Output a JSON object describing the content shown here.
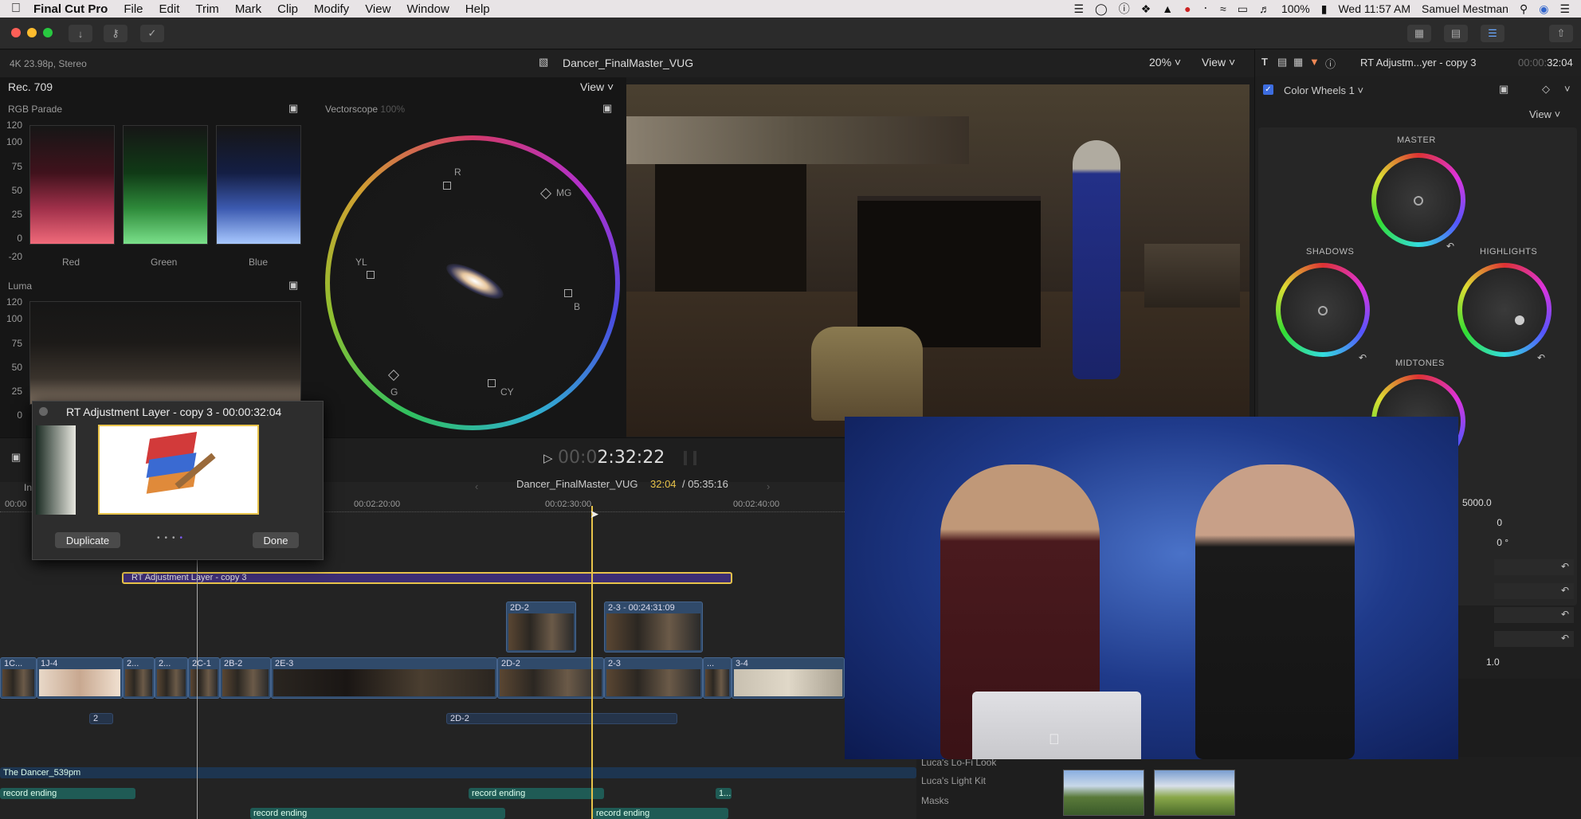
{
  "menubar": {
    "app": "Final Cut Pro",
    "items": [
      "File",
      "Edit",
      "Trim",
      "Mark",
      "Clip",
      "Modify",
      "View",
      "Window",
      "Help"
    ],
    "battery": "100%",
    "clock": "Wed 11:57 AM",
    "user": "Samuel Mestman"
  },
  "viewer_header": {
    "format": "4K 23.98p, Stereo",
    "project": "Dancer_FinalMaster_VUG",
    "zoom": "20%",
    "view_label": "View"
  },
  "scopes": {
    "colorspace": "Rec. 709",
    "view_label": "View",
    "rgb_title": "RGB Parade",
    "channels": [
      "Red",
      "Green",
      "Blue"
    ],
    "scale": [
      "120",
      "100",
      "75",
      "50",
      "25",
      "0",
      "-20"
    ],
    "luma_title": "Luma",
    "vector_title": "Vectorscope",
    "vector_pct": "100%",
    "vector_targets": [
      "R",
      "MG",
      "YL",
      "B",
      "G",
      "CY"
    ]
  },
  "inspector": {
    "title": "RT Adjustm...yer - copy 3",
    "time_dim": "00:00:",
    "time": "32:04",
    "effect": "Color Wheels 1",
    "view_label": "View",
    "wheels": [
      "MASTER",
      "SHADOWS",
      "HIGHLIGHTS",
      "MIDTONES"
    ],
    "values": [
      "5000.0",
      "0",
      "0 °",
      "1.0"
    ]
  },
  "playhead": {
    "dim": "00:0",
    "time": "2:32:22"
  },
  "timeline_header": {
    "project": "Dancer_FinalMaster_VUG",
    "current": "32:04",
    "total": "/ 05:35:16"
  },
  "ruler": [
    "00:00",
    "00:02:20:00",
    "00:02:30:00",
    "00:02:40:00"
  ],
  "adjustment_layer": "RT Adjustment Layer - copy 3",
  "connected_clips": [
    "2D-2",
    "2-3 - 00:24:31:09"
  ],
  "primary_clips": [
    "1C...",
    "1J-4",
    "2...",
    "2...",
    "2C-1",
    "2B-2",
    "2E-3",
    "2D-2",
    "2-3",
    "...",
    "3-4"
  ],
  "lower_clips": [
    "2",
    "2D-2"
  ],
  "audio": {
    "music": "The Dancer_539pm",
    "rec": [
      "record ending",
      "record ending",
      "1...",
      "record ending",
      "record ending"
    ]
  },
  "browser_items": [
    "Luca's Lo-Fi Look",
    "Luca's Light Kit",
    "Masks"
  ],
  "popup": {
    "title": "RT Adjustment Layer - copy 3 - 00:00:32:04",
    "duplicate": "Duplicate",
    "done": "Done"
  },
  "colors": {
    "accent": "#7c5cf0",
    "playhead": "#e8c34a",
    "clip_blue": "#304a6a",
    "audio_teal": "#1f5b55"
  }
}
